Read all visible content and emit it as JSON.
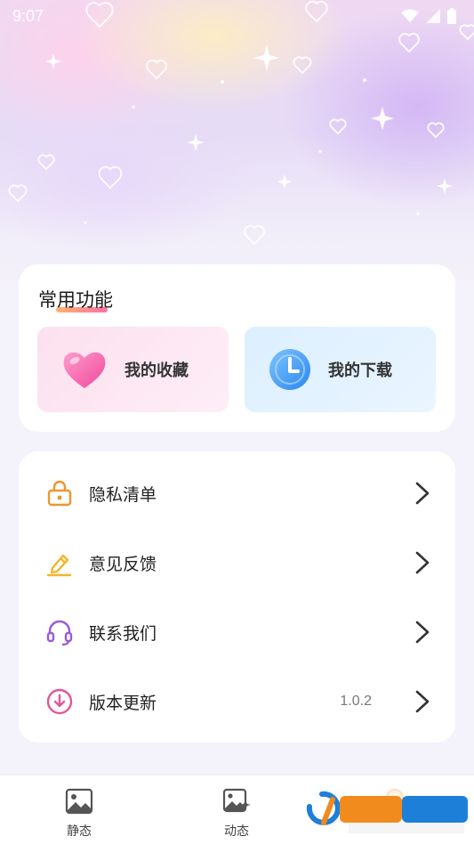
{
  "status_bar": {
    "time": "9:07"
  },
  "common_functions": {
    "title": "常用功能",
    "favorites_label": "我的收藏",
    "downloads_label": "我的下载"
  },
  "settings_list": {
    "items": [
      {
        "label": "隐私清单",
        "icon": "lock-icon"
      },
      {
        "label": "意见反馈",
        "icon": "pencil-icon"
      },
      {
        "label": "联系我们",
        "icon": "headset-icon"
      },
      {
        "label": "版本更新",
        "icon": "download-circle-icon",
        "value": "1.0.2"
      }
    ]
  },
  "tabbar": {
    "tabs": [
      {
        "label": "静态",
        "icon": "image-icon"
      },
      {
        "label": "动态",
        "icon": "animated-image-icon"
      },
      {
        "label": "",
        "icon": "profile-icon"
      }
    ]
  },
  "colors": {
    "lock": "#f0952f",
    "pencil": "#f2b62a",
    "headset": "#9a5ad8",
    "download": "#e2569a",
    "background": "#f4f2fb"
  }
}
